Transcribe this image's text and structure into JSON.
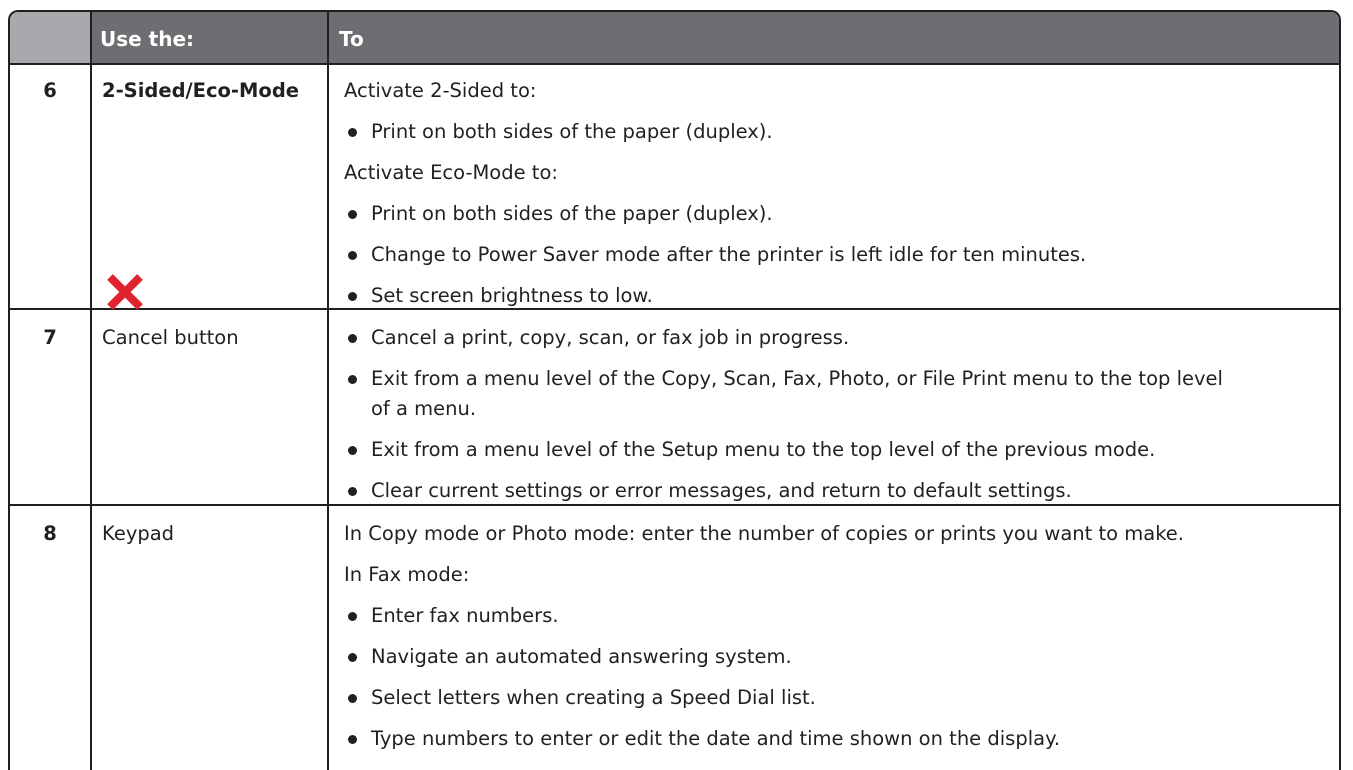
{
  "header": {
    "col1": "",
    "col2": "Use the:",
    "col3": "To"
  },
  "rows": [
    {
      "number": "6",
      "label": "2-Sided/Eco-Mode",
      "lines": [
        "Activate 2-Sided to:",
        "Print on both sides of the paper (duplex).",
        "Activate Eco-Mode to:",
        "Print on both sides of the paper (duplex).",
        "Change to Power Saver mode after the printer is left idle for ten minutes.",
        "Set screen brightness to low."
      ]
    },
    {
      "number": "7",
      "label": "Cancel button",
      "icon": "cancel-x-icon",
      "icon_color": "#e0242f",
      "lines": [
        "Cancel a print, copy, scan, or fax job in progress.",
        "Exit from a menu level of the Copy, Scan, Fax, Photo, or File Print menu to the top level",
        "of a menu.",
        "Exit from a menu level of the Setup menu to the top level of the previous mode.",
        "Clear current settings or error messages, and return to default settings."
      ]
    },
    {
      "number": "8",
      "label": "Keypad",
      "lines": [
        "In Copy mode or Photo mode: enter the number of copies or prints you want to make.",
        "In Fax mode:",
        "Enter fax numbers.",
        "Navigate an automated answering system.",
        "Select letters when creating a Speed Dial list.",
        "Type numbers to enter or edit the date and time shown on the display."
      ]
    }
  ],
  "colors": {
    "header_bg": "#6d6e71",
    "header_first_cell_bg": "#a7a9ac",
    "text": "#231f20",
    "cancel_icon": "#e0242f"
  }
}
